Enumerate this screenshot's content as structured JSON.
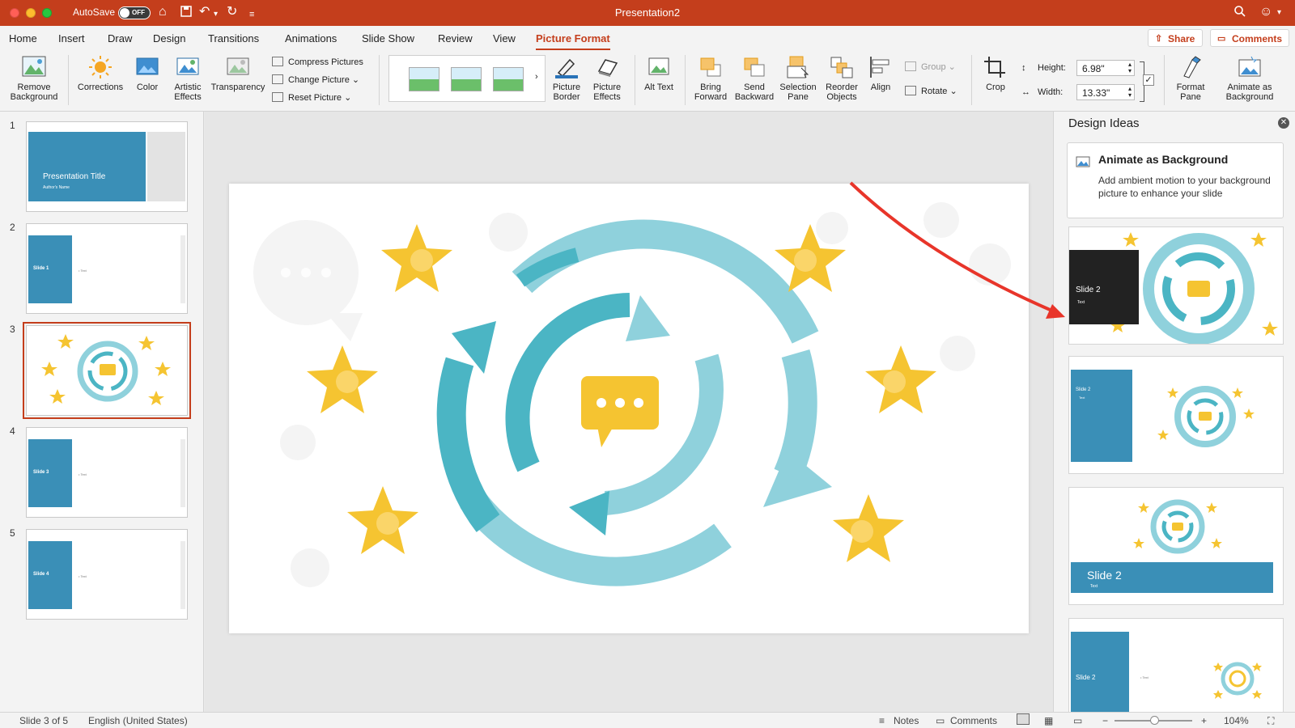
{
  "titlebar": {
    "autosave_label": "AutoSave",
    "autosave_state": "OFF",
    "doc_title": "Presentation2"
  },
  "menu": {
    "tabs": [
      "Home",
      "Insert",
      "Draw",
      "Design",
      "Transitions",
      "Animations",
      "Slide Show",
      "Review",
      "View",
      "Picture Format"
    ],
    "active_tab": "Picture Format",
    "share": "Share",
    "comments": "Comments"
  },
  "ribbon": {
    "remove_background": "Remove Background",
    "corrections": "Corrections",
    "color": "Color",
    "artistic_effects": "Artistic Effects",
    "transparency": "Transparency",
    "compress_pictures": "Compress Pictures",
    "change_picture": "Change Picture",
    "reset_picture": "Reset Picture",
    "picture_border": "Picture Border",
    "picture_effects": "Picture Effects",
    "alt_text": "Alt Text",
    "bring_forward": "Bring Forward",
    "send_backward": "Send Backward",
    "selection_pane": "Selection Pane",
    "reorder_objects": "Reorder Objects",
    "align": "Align",
    "group": "Group",
    "rotate": "Rotate",
    "crop": "Crop",
    "height_label": "Height:",
    "height_value": "6.98\"",
    "width_label": "Width:",
    "width_value": "13.33\"",
    "format_pane": "Format Pane",
    "animate_as_background": "Animate as Background"
  },
  "thumbnails": {
    "slides": [
      {
        "num": "1",
        "title": "Presentation Title",
        "subtitle": "Author's Name"
      },
      {
        "num": "2",
        "title": "Slide 1",
        "body": "• Text"
      },
      {
        "num": "3",
        "title": "",
        "body": ""
      },
      {
        "num": "4",
        "title": "Slide 3",
        "body": "• Text"
      },
      {
        "num": "5",
        "title": "Slide 4",
        "body": "• Text"
      }
    ],
    "selected": "3"
  },
  "design_ideas": {
    "title": "Design Ideas",
    "close": "✕",
    "anim_card_title": "Animate as Background",
    "anim_card_desc": "Add ambient motion to your background picture to enhance your slide",
    "idea1_title": "Slide 2",
    "idea1_text": "Text",
    "idea2_title": "Slide 2",
    "idea2_text": "Text",
    "idea3_title": "Slide 2",
    "idea3_text": "Text",
    "idea4_title": "Slide 2",
    "idea4_text": "• Text"
  },
  "statusbar": {
    "slide_info": "Slide 3 of 5",
    "language": "English (United States)",
    "notes": "Notes",
    "comments": "Comments",
    "zoom": "104%"
  },
  "colors": {
    "accent": "#c43e1c",
    "slide_blue": "#3a8fb7",
    "teal": "#4bb5c4",
    "light_teal": "#8fd1dc",
    "star": "#f5c431",
    "arrow_annotation": "#e8352a"
  }
}
